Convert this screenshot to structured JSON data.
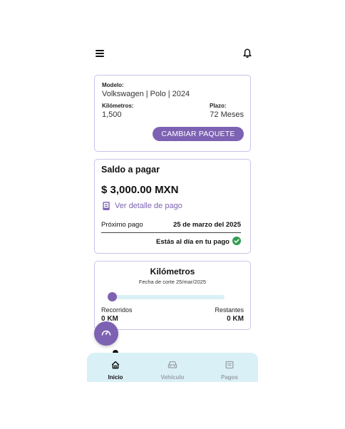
{
  "header": {
    "menu_icon": "hamburger-icon",
    "bell_icon": "bell-icon"
  },
  "vehicle_card": {
    "model_label": "Modelo:",
    "model_value": "Volkswagen | Polo | 2024",
    "km_label": "Kilómetros:",
    "km_value": "1,500",
    "term_label": "Plazo:",
    "term_value": "72 Meses",
    "change_button": "CAMBIAR PAQUETE"
  },
  "balance_card": {
    "title": "Saldo a pagar",
    "amount": "$ 3,000.00 MXN",
    "detail_link": "Ver detalle de pago",
    "next_payment_label": "Próximo pago",
    "next_payment_date": "25 de marzo del 2025",
    "status": "Estás al día en tu pago"
  },
  "km_card": {
    "title": "Kilómetros",
    "subtitle": "Fecha de corte 25/mar/2025",
    "progress": 0,
    "traveled_label": "Recorridos",
    "traveled_value": "0 KM",
    "remaining_label": "Restantes",
    "remaining_value": "0 KM"
  },
  "bottom_nav": {
    "items": [
      {
        "label": "Inicio",
        "icon": "home-icon",
        "active": true
      },
      {
        "label": "Vehículo",
        "icon": "car-icon",
        "active": false
      },
      {
        "label": "Pagos",
        "icon": "wallet-icon",
        "active": false
      }
    ]
  },
  "colors": {
    "accent": "#7d62b3",
    "nav_bg": "#d9f0f7",
    "card_border": "#c9c4ea",
    "success": "#2e9e4f"
  }
}
